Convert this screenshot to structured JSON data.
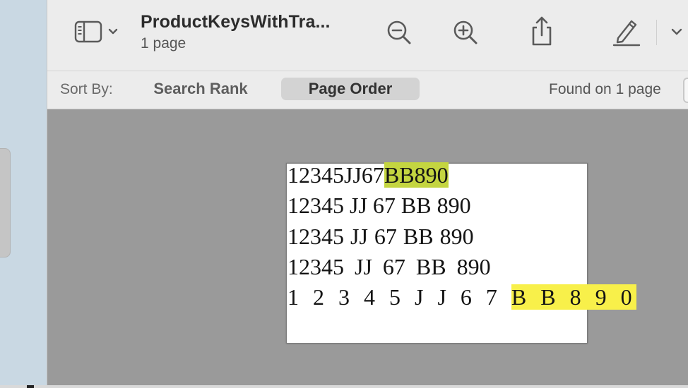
{
  "window": {
    "title": "ProductKeysWithTra...",
    "subtitle": "1 page"
  },
  "toolbar": {
    "sidebar_icon": "sidebar-icon",
    "zoom_out_icon": "zoom-out-icon",
    "zoom_in_icon": "zoom-in-icon",
    "share_icon": "share-icon",
    "markup_icon": "pencil-icon",
    "markup_more_icon": "chevron-down-icon"
  },
  "search": {
    "sort_label": "Sort By:",
    "sort_options": [
      "Search Rank",
      "Page Order"
    ],
    "selected_sort": "Page Order",
    "found_text": "Found on 1 page"
  },
  "document": {
    "lines": [
      {
        "before": "12345JJ67",
        "match": "BB890",
        "after": ""
      },
      {
        "before": "12345 JJ 67 BB 890",
        "match": "",
        "after": ""
      },
      {
        "before": "12345 JJ 67 BB 890",
        "match": "",
        "after": ""
      },
      {
        "before": "12345 JJ 67 BB 890",
        "match": "",
        "after": ""
      },
      {
        "before": "1 2 3 4 5 J J 6 7 ",
        "match": "B B 8 9 0",
        "after": ""
      }
    ]
  },
  "colors": {
    "current_match": "#c4d540",
    "match": "#f8f04a",
    "viewer_bg": "#9a9a9a"
  }
}
